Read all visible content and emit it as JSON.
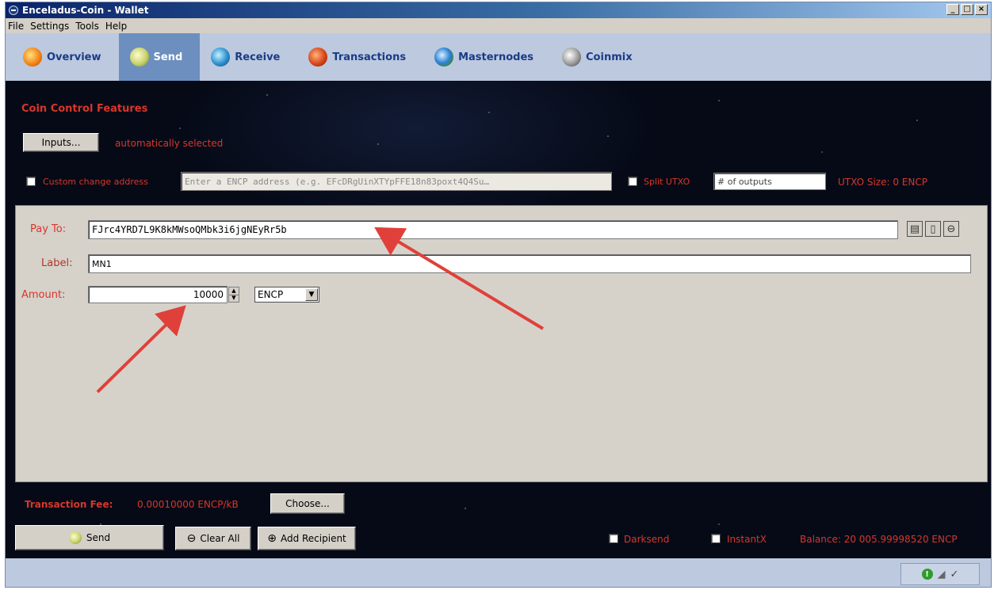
{
  "window": {
    "title": "Enceladus-Coin - Wallet"
  },
  "menu": [
    "File",
    "Settings",
    "Tools",
    "Help"
  ],
  "tabs": [
    {
      "label": "Overview",
      "icon": "overview-icon"
    },
    {
      "label": "Send",
      "icon": "send-icon",
      "active": true
    },
    {
      "label": "Receive",
      "icon": "receive-icon"
    },
    {
      "label": "Transactions",
      "icon": "transactions-icon"
    },
    {
      "label": "Masternodes",
      "icon": "masternodes-icon"
    },
    {
      "label": "Coinmix",
      "icon": "coinmix-icon"
    }
  ],
  "coin_control": {
    "title": "Coin Control Features",
    "inputs_button": "Inputs...",
    "auto_selected": "automatically selected",
    "custom_change_label": "Custom change address",
    "custom_change_placeholder": "Enter a ENCP address (e.g. EFcDRgUinXTYpFFE18n83poxt4Q4Su…",
    "split_utxo_label": "Split UTXO",
    "outputs_placeholder": "# of outputs",
    "utxo_size": "UTXO Size:  0 ENCP"
  },
  "recipient": {
    "pay_to_label": "Pay To:",
    "pay_to_value": "FJrc4YRD7L9K8kMWsoQMbk3i6jgNEyRr5b",
    "label_label": "Label:",
    "label_value": "MN1",
    "amount_label": "Amount:",
    "amount_value": "10000",
    "unit": "ENCP"
  },
  "fee": {
    "label": "Transaction Fee:",
    "value": "0.00010000 ENCP/kB",
    "choose_button": "Choose..."
  },
  "actions": {
    "send": "Send",
    "clear_all": "Clear All",
    "add_recipient": "Add Recipient",
    "darksend": "Darksend",
    "instantx": "InstantX",
    "balance": "Balance: 20 005.99998520 ENCP"
  },
  "colors": {
    "accent_red": "#d8362a",
    "tab_active": "#6d8fbf",
    "panel": "#d6d2ca"
  }
}
